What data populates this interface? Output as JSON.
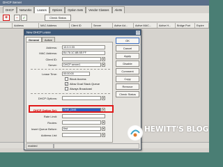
{
  "window": {
    "title": "DHCP Server",
    "tabs": [
      "DHCP",
      "Networks",
      "Leases",
      "Options",
      "Option Sets",
      "Vendor Classes",
      "Alerts"
    ],
    "active_tab": "Leases",
    "toolbar": {
      "add": "+",
      "remove": "−",
      "filter": "✓",
      "check_status": "Check Status"
    },
    "columns": [
      "Address",
      "MAC Address",
      "Client ID",
      "Server",
      "Active Ad...",
      "Active MAC...",
      "Active H...",
      "Bridge Port",
      "Expire"
    ]
  },
  "dialog": {
    "title": "New DHCP Lease",
    "close": "□",
    "tabs": [
      "General",
      "Active"
    ],
    "active_tab": "General",
    "fields": {
      "address": {
        "label": "Address:",
        "value": "10.0.0.33"
      },
      "mac_address": {
        "label": "MAC Address:",
        "value": "B4:76:1C:8B:5E:FF"
      },
      "client_id": {
        "label": "Client ID:",
        "value": ""
      },
      "server": {
        "label": "Server:",
        "value": "DHCP server1"
      },
      "lease_time": {
        "label": "Lease Time:",
        "value": "00:00:00"
      },
      "block_access": {
        "label": "Block Access",
        "checked": false
      },
      "allow_dual_stack": {
        "label": "Allow Dual Stack Queue",
        "checked": true
      },
      "always_broadcast": {
        "label": "Always Broadcast",
        "checked": false
      },
      "dhcp_options": {
        "label": "DHCP Options:",
        "value": ""
      },
      "dhcp_option_set": {
        "label": "DHCP Option Set:",
        "value": "ONE_DNS"
      },
      "rate_limit": {
        "label": "Rate Limit:",
        "value": ""
      },
      "routes": {
        "label": "Routes:",
        "value": ""
      },
      "insert_queue_before": {
        "label": "Insert Queue Before:",
        "value": "first"
      },
      "address_list": {
        "label": "Address List:",
        "value": ""
      }
    },
    "buttons": [
      "OK",
      "Cancel",
      "Apply",
      "Disable",
      "Comment",
      "Copy",
      "Remove",
      "Check Status"
    ],
    "status": {
      "state": "enabled",
      "busy": ""
    }
  },
  "watermark": {
    "title": "HEWITT'S BLOG",
    "subtitle": ""
  },
  "colors": {
    "highlight_border": "#e01818",
    "selection": "#2b5dc4",
    "title_bar": "#3d5878"
  }
}
